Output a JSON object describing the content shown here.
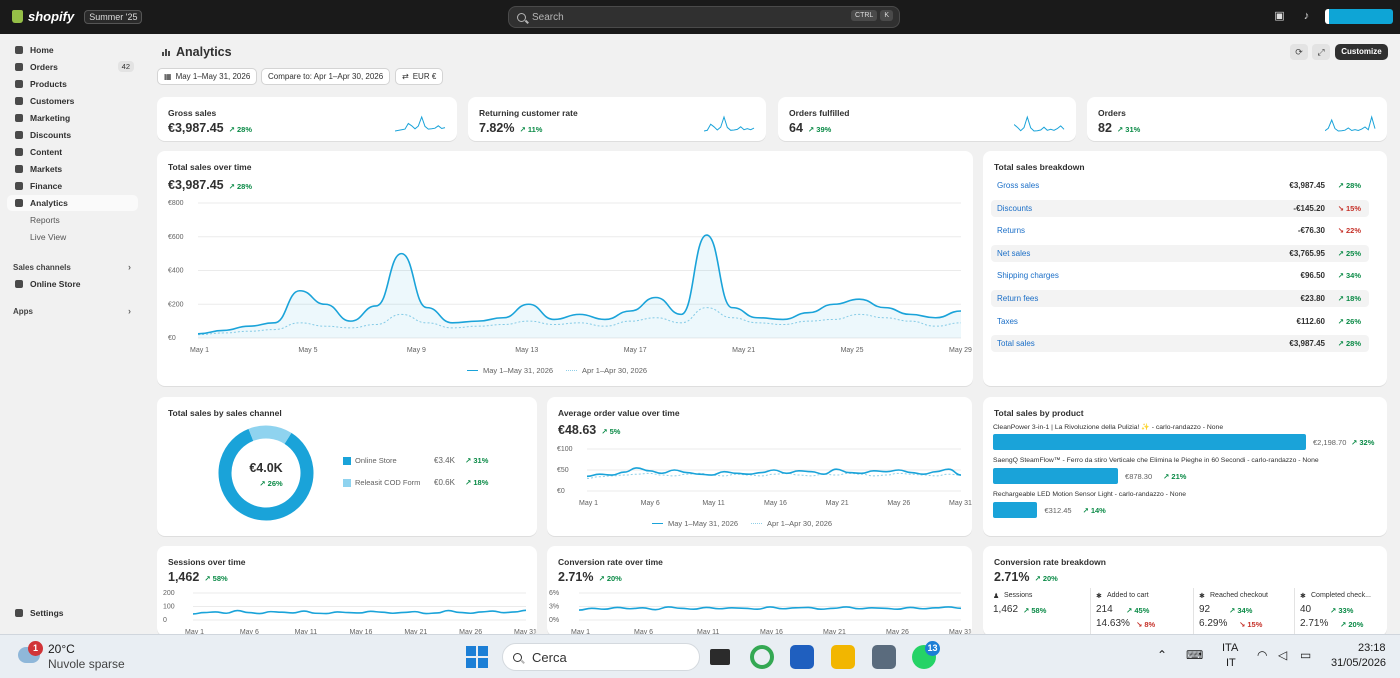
{
  "topbar": {
    "brand": "shopify",
    "edition": "Summer '25",
    "search_placeholder": "Search",
    "shortcut_keys": [
      "CTRL",
      "K"
    ]
  },
  "sidebar": {
    "items": [
      {
        "label": "Home",
        "icon": "home-icon"
      },
      {
        "label": "Orders",
        "icon": "orders-icon",
        "badge": "42"
      },
      {
        "label": "Products",
        "icon": "tag-icon"
      },
      {
        "label": "Customers",
        "icon": "person-icon"
      },
      {
        "label": "Marketing",
        "icon": "target-icon"
      },
      {
        "label": "Discounts",
        "icon": "discount-icon"
      },
      {
        "label": "Content",
        "icon": "content-icon"
      },
      {
        "label": "Markets",
        "icon": "globe-icon"
      },
      {
        "label": "Finance",
        "icon": "bank-icon"
      },
      {
        "label": "Analytics",
        "icon": "chart-icon",
        "active": true
      }
    ],
    "sub_items": [
      "Reports",
      "Live View"
    ],
    "sales_channels_label": "Sales channels",
    "online_store_label": "Online Store",
    "apps_label": "Apps",
    "settings_label": "Settings"
  },
  "header": {
    "title": "Analytics",
    "date_range": "May 1–May 31, 2026",
    "compare": "Compare to: Apr 1–Apr 30, 2026",
    "currency": "EUR €",
    "customize_label": "Customize"
  },
  "kpis": [
    {
      "label": "Gross sales",
      "value": "€3,987.45",
      "delta": "28%"
    },
    {
      "label": "Returning customer rate",
      "value": "7.82%",
      "delta": "11%"
    },
    {
      "label": "Orders fulfilled",
      "value": "64",
      "delta": "39%"
    },
    {
      "label": "Orders",
      "value": "82",
      "delta": "31%"
    }
  ],
  "total_sales": {
    "title": "Total sales over time",
    "value": "€3,987.45",
    "delta": "28%",
    "legend_current": "May 1–May 31, 2026",
    "legend_previous": "Apr 1–Apr 30, 2026"
  },
  "breakdown": {
    "title": "Total sales breakdown",
    "rows": [
      {
        "label": "Gross sales",
        "value": "€3,987.45",
        "delta": "28%",
        "neg": false
      },
      {
        "label": "Discounts",
        "value": "-€145.20",
        "delta": "15%",
        "neg": true
      },
      {
        "label": "Returns",
        "value": "-€76.30",
        "delta": "22%",
        "neg": true
      },
      {
        "label": "Net sales",
        "value": "€3,765.95",
        "delta": "25%",
        "neg": false
      },
      {
        "label": "Shipping charges",
        "value": "€96.50",
        "delta": "34%",
        "neg": false
      },
      {
        "label": "Return fees",
        "value": "€23.80",
        "delta": "18%",
        "neg": false
      },
      {
        "label": "Taxes",
        "value": "€112.60",
        "delta": "26%",
        "neg": false
      },
      {
        "label": "Total sales",
        "value": "€3,987.45",
        "delta": "28%",
        "neg": false
      }
    ]
  },
  "channels": {
    "title": "Total sales by sales channel",
    "center_value": "€4.0K",
    "center_delta": "26%",
    "items": [
      {
        "label": "Online Store",
        "value": "€3.4K",
        "delta": "31%",
        "share": 0.85,
        "color": "#1aa3d9"
      },
      {
        "label": "Releasit COD Form",
        "value": "€0.6K",
        "delta": "18%",
        "share": 0.15,
        "color": "#8fd3ef"
      }
    ]
  },
  "aov": {
    "title": "Average order value over time",
    "value": "€48.63",
    "delta": "5%",
    "legend_current": "May 1–May 31, 2026",
    "legend_previous": "Apr 1–Apr 30, 2026"
  },
  "products": {
    "title": "Total sales by product",
    "items": [
      {
        "name": "CleanPower 3-in-1 | La Rivoluzione della Pulizia! ✨ - carlo-randazzo - None",
        "value": "€2,198.70",
        "delta": "32%",
        "amount": 2198.7
      },
      {
        "name": "SaengQ SteamFlow™ - Ferro da stiro Verticale che Elimina le Pieghe in 60 Secondi - carlo-randazzo - None",
        "value": "€878.30",
        "delta": "21%",
        "amount": 878.3
      },
      {
        "name": "Rechargeable LED Motion Sensor Light - carlo-randazzo - None",
        "value": "€312.45",
        "delta": "14%",
        "amount": 312.45
      }
    ]
  },
  "sessions": {
    "title": "Sessions over time",
    "value": "1,462",
    "delta": "58%"
  },
  "conversion": {
    "title": "Conversion rate over time",
    "value": "2.71%",
    "delta": "20%"
  },
  "conv_breakdown": {
    "title": "Conversion rate breakdown",
    "value": "2.71%",
    "delta": "20%",
    "steps": [
      {
        "label": "Sessions",
        "value": "1,462",
        "delta": "58%",
        "rate": "",
        "rate_delta": ""
      },
      {
        "label": "Added to cart",
        "value": "214",
        "delta": "45%",
        "rate": "14.63%",
        "rate_delta": "8%"
      },
      {
        "label": "Reached checkout",
        "value": "92",
        "delta": "34%",
        "rate": "6.29%",
        "rate_delta": "15%"
      },
      {
        "label": "Completed check...",
        "value": "40",
        "delta": "33%",
        "rate": "2.71%",
        "rate_delta": "20%"
      }
    ]
  },
  "chart_data": [
    {
      "type": "line",
      "title": "Total sales over time",
      "x": [
        1,
        2,
        3,
        4,
        5,
        6,
        7,
        8,
        9,
        10,
        11,
        12,
        13,
        14,
        15,
        16,
        17,
        18,
        19,
        20,
        21,
        22,
        23,
        24,
        25,
        26,
        27,
        28,
        29,
        30,
        31
      ],
      "x_ticks": [
        "May 1",
        "May 5",
        "May 9",
        "May 13",
        "May 17",
        "May 21",
        "May 25",
        "May 29"
      ],
      "y_ticks": [
        "€0",
        "€200",
        "€400",
        "€600",
        "€800"
      ],
      "ylim": [
        0,
        800
      ],
      "series": [
        {
          "name": "May 1–May 31, 2026",
          "values": [
            25,
            45,
            70,
            90,
            280,
            200,
            100,
            190,
            500,
            180,
            90,
            100,
            120,
            200,
            110,
            140,
            110,
            160,
            240,
            140,
            610,
            180,
            120,
            110,
            150,
            200,
            230,
            180,
            140,
            120,
            160
          ]
        },
        {
          "name": "Apr 1–Apr 30, 2026",
          "values": [
            20,
            30,
            40,
            50,
            90,
            70,
            60,
            80,
            140,
            90,
            60,
            70,
            80,
            100,
            80,
            90,
            70,
            100,
            120,
            90,
            180,
            120,
            90,
            80,
            100,
            110,
            140,
            120,
            100,
            70,
            90
          ]
        }
      ]
    },
    {
      "type": "line",
      "title": "Average order value over time",
      "x_ticks": [
        "May 1",
        "May 6",
        "May 11",
        "May 16",
        "May 21",
        "May 26",
        "May 31"
      ],
      "y_ticks": [
        "€0",
        "€50",
        "€100"
      ],
      "ylim": [
        0,
        100
      ],
      "series": [
        {
          "name": "May 1–May 31, 2026",
          "values": [
            35,
            40,
            38,
            45,
            55,
            48,
            42,
            50,
            44,
            40,
            38,
            46,
            42,
            40,
            44,
            50,
            42,
            48,
            46,
            40,
            52,
            44,
            42,
            48,
            46,
            50,
            44,
            40,
            46,
            52,
            38
          ]
        },
        {
          "name": "Apr 1–Apr 30, 2026",
          "values": [
            30,
            34,
            36,
            38,
            40,
            42,
            38,
            36,
            40,
            42,
            38,
            36,
            40,
            38,
            36,
            40,
            42,
            38,
            36,
            40,
            38,
            42,
            40,
            36,
            38,
            42,
            40,
            38,
            36,
            40,
            38
          ]
        }
      ]
    },
    {
      "type": "line",
      "title": "Sessions over time",
      "x_ticks": [
        "May 1",
        "May 6",
        "May 11",
        "May 16",
        "May 21",
        "May 26",
        "May 31"
      ],
      "y_ticks": [
        "0",
        "100",
        "200"
      ],
      "ylim": [
        0,
        200
      ],
      "series": [
        {
          "name": "May 1–May 31, 2026",
          "values": [
            45,
            55,
            60,
            50,
            70,
            55,
            48,
            62,
            58,
            52,
            66,
            50,
            48,
            60,
            55,
            52,
            64,
            58,
            50,
            56,
            62,
            48,
            52,
            70,
            56,
            50,
            60,
            66,
            54,
            60,
            72
          ]
        }
      ]
    },
    {
      "type": "line",
      "title": "Conversion rate over time",
      "x_ticks": [
        "May 1",
        "May 6",
        "May 11",
        "May 16",
        "May 21",
        "May 26",
        "May 31"
      ],
      "y_ticks": [
        "0%",
        "3%",
        "6%"
      ],
      "ylim": [
        0,
        6
      ],
      "series": [
        {
          "name": "May 1–May 31, 2026",
          "values": [
            2.2,
            2.6,
            2.4,
            2.8,
            2.5,
            2.7,
            2.3,
            2.9,
            2.6,
            2.4,
            2.8,
            2.5,
            2.7,
            2.6,
            2.4,
            2.9,
            2.5,
            2.7,
            2.8,
            2.4,
            2.6,
            2.9,
            2.5,
            2.7,
            2.6,
            2.4,
            2.8,
            2.5,
            2.7,
            2.9,
            2.6
          ]
        }
      ]
    }
  ],
  "taskbar": {
    "weather_temp": "20°C",
    "weather_desc": "Nuvole sparse",
    "weather_badge": "1",
    "search_label": "Cerca",
    "whatsapp_badge": "13",
    "lang_top": "ITA",
    "lang_bottom": "IT",
    "time": "23:18",
    "date": "31/05/2026"
  },
  "colors": {
    "accent": "#1aa3d9",
    "positive": "#0a8a46",
    "negative": "#c6322a",
    "topbar": "#1a1a1a"
  }
}
